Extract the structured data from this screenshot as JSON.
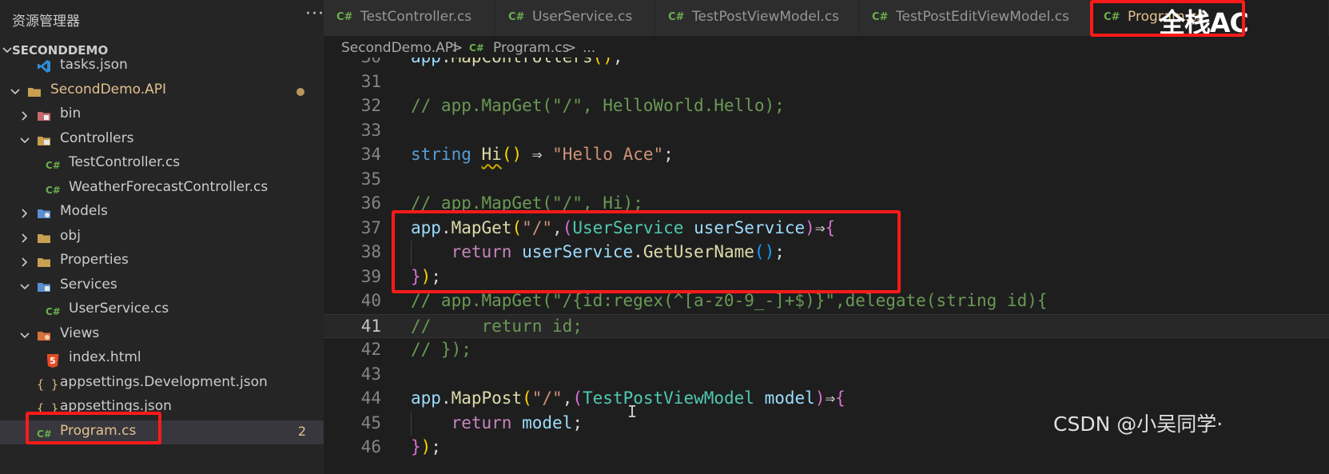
{
  "explorer": {
    "title": "资源管理器",
    "more": "···",
    "project": "SECONDDEMO",
    "tree": [
      {
        "label": "tasks.json",
        "icon": "vscode-icon",
        "depth": 2,
        "chevron": ""
      },
      {
        "label": "SecondDemo.API",
        "icon": "folder-icon",
        "depth": 1,
        "chevron": "open",
        "modified": true
      },
      {
        "label": "bin",
        "icon": "bin-folder-icon",
        "depth": 2,
        "chevron": "closed"
      },
      {
        "label": "Controllers",
        "icon": "controllers-folder-icon",
        "depth": 2,
        "chevron": "open"
      },
      {
        "label": "TestController.cs",
        "icon": "csharp-icon",
        "depth": 3,
        "chevron": ""
      },
      {
        "label": "WeatherForecastController.cs",
        "icon": "csharp-icon",
        "depth": 3,
        "chevron": ""
      },
      {
        "label": "Models",
        "icon": "models-folder-icon",
        "depth": 2,
        "chevron": "closed"
      },
      {
        "label": "obj",
        "icon": "folder-icon",
        "depth": 2,
        "chevron": "closed"
      },
      {
        "label": "Properties",
        "icon": "folder-icon",
        "depth": 2,
        "chevron": "closed"
      },
      {
        "label": "Services",
        "icon": "services-folder-icon",
        "depth": 2,
        "chevron": "open"
      },
      {
        "label": "UserService.cs",
        "icon": "csharp-icon",
        "depth": 3,
        "chevron": ""
      },
      {
        "label": "Views",
        "icon": "views-folder-icon",
        "depth": 2,
        "chevron": "open"
      },
      {
        "label": "index.html",
        "icon": "html5-icon",
        "depth": 3,
        "chevron": ""
      },
      {
        "label": "appsettings.Development.json",
        "icon": "json-icon",
        "depth": 2,
        "chevron": ""
      },
      {
        "label": "appsettings.json",
        "icon": "json-icon",
        "depth": 2,
        "chevron": ""
      },
      {
        "label": "Program.cs",
        "icon": "csharp-icon",
        "depth": 2,
        "chevron": "",
        "selected": true,
        "badge": "2"
      }
    ]
  },
  "tabs": [
    {
      "label": "TestController.cs",
      "icon": "C#"
    },
    {
      "label": "UserService.cs",
      "icon": "C#"
    },
    {
      "label": "TestPostViewModel.cs",
      "icon": "C#"
    },
    {
      "label": "TestPostEditViewModel.cs",
      "icon": "C#"
    },
    {
      "label": "Program.cs",
      "icon": "C#",
      "active": true
    }
  ],
  "breadcrumb": {
    "project": "SecondDemo.API",
    "sep": ">",
    "file_icon": "C#",
    "file": "Program.cs",
    "sep2": ">",
    "tail": "..."
  },
  "editor": {
    "current_line": "41",
    "lines": [
      {
        "n": "30",
        "t": [
          [
            "app",
            "tok-ident"
          ],
          [
            ".",
            "tok-punct"
          ],
          [
            "MapControllers",
            "tok-method"
          ],
          [
            "(",
            "tok-paren1"
          ],
          [
            ")",
            "tok-paren1"
          ],
          [
            ";",
            "tok-punct"
          ]
        ]
      },
      {
        "n": "31",
        "t": []
      },
      {
        "n": "32",
        "t": [
          [
            "// app.MapGet(\"/\", HelloWorld.Hello);",
            "tok-comment"
          ]
        ]
      },
      {
        "n": "33",
        "t": []
      },
      {
        "n": "34",
        "t": [
          [
            "string",
            "tok-kw"
          ],
          [
            " ",
            "tok-punct"
          ],
          [
            "Hi",
            "tok-method squiggle"
          ],
          [
            "(",
            "tok-paren1"
          ],
          [
            ")",
            "tok-paren1"
          ],
          [
            " ⇒ ",
            "tok-punct"
          ],
          [
            "\"Hello Ace\"",
            "tok-str"
          ],
          [
            ";",
            "tok-punct"
          ]
        ]
      },
      {
        "n": "35",
        "t": []
      },
      {
        "n": "36",
        "t": [
          [
            "// app.MapGet(\"/\", Hi);",
            "tok-comment"
          ]
        ]
      },
      {
        "n": "37",
        "t": [
          [
            "app",
            "tok-ident"
          ],
          [
            ".",
            "tok-punct"
          ],
          [
            "MapGet",
            "tok-method"
          ],
          [
            "(",
            "tok-paren1"
          ],
          [
            "\"/\"",
            "tok-str"
          ],
          [
            ",",
            "tok-punct"
          ],
          [
            "(",
            "tok-paren2"
          ],
          [
            "UserService",
            "tok-type"
          ],
          [
            " ",
            "tok-punct"
          ],
          [
            "userService",
            "tok-ident"
          ],
          [
            ")",
            "tok-paren2"
          ],
          [
            "⇒",
            "tok-punct"
          ],
          [
            "{",
            "tok-paren2"
          ]
        ]
      },
      {
        "n": "38",
        "t": [
          [
            "    ",
            "tok-punct"
          ],
          [
            "return",
            "tok-ctrl"
          ],
          [
            " ",
            "tok-punct"
          ],
          [
            "userService",
            "tok-ident"
          ],
          [
            ".",
            "tok-punct"
          ],
          [
            "GetUserName",
            "tok-method"
          ],
          [
            "(",
            "tok-paren3"
          ],
          [
            ")",
            "tok-paren3"
          ],
          [
            ";",
            "tok-punct"
          ]
        ]
      },
      {
        "n": "39",
        "t": [
          [
            "}",
            "tok-paren2"
          ],
          [
            ")",
            "tok-paren1"
          ],
          [
            ";",
            "tok-punct"
          ]
        ]
      },
      {
        "n": "40",
        "t": [
          [
            "// app.MapGet(\"/{id:regex(^[a-z0-9_-]+$)}\",delegate(string id){",
            "tok-comment"
          ]
        ]
      },
      {
        "n": "41",
        "t": [
          [
            "//     return id;",
            "tok-comment"
          ]
        ]
      },
      {
        "n": "42",
        "t": [
          [
            "// });",
            "tok-comment"
          ]
        ]
      },
      {
        "n": "43",
        "t": []
      },
      {
        "n": "44",
        "t": [
          [
            "app",
            "tok-ident"
          ],
          [
            ".",
            "tok-punct"
          ],
          [
            "MapPost",
            "tok-method"
          ],
          [
            "(",
            "tok-paren1"
          ],
          [
            "\"/\"",
            "tok-str"
          ],
          [
            ",",
            "tok-punct"
          ],
          [
            "(",
            "tok-paren2"
          ],
          [
            "TestPostViewModel",
            "tok-type"
          ],
          [
            " ",
            "tok-punct"
          ],
          [
            "model",
            "tok-ident"
          ],
          [
            ")",
            "tok-paren2"
          ],
          [
            "⇒",
            "tok-punct"
          ],
          [
            "{",
            "tok-paren2"
          ]
        ]
      },
      {
        "n": "45",
        "t": [
          [
            "    ",
            "tok-punct"
          ],
          [
            "return",
            "tok-ctrl"
          ],
          [
            " ",
            "tok-punct"
          ],
          [
            "model",
            "tok-ident"
          ],
          [
            ";",
            "tok-punct"
          ]
        ]
      },
      {
        "n": "46",
        "t": [
          [
            "}",
            "tok-paren2"
          ],
          [
            ")",
            "tok-paren1"
          ],
          [
            ";",
            "tok-punct"
          ]
        ]
      }
    ]
  },
  "watermarks": {
    "top": "全栈AC",
    "bottom": "CSDN @小吴同学·"
  },
  "colors": {
    "highlight_box": "#ff1a1a",
    "modified": "#e2c08d",
    "csharp_icon": "#6ab04c"
  }
}
